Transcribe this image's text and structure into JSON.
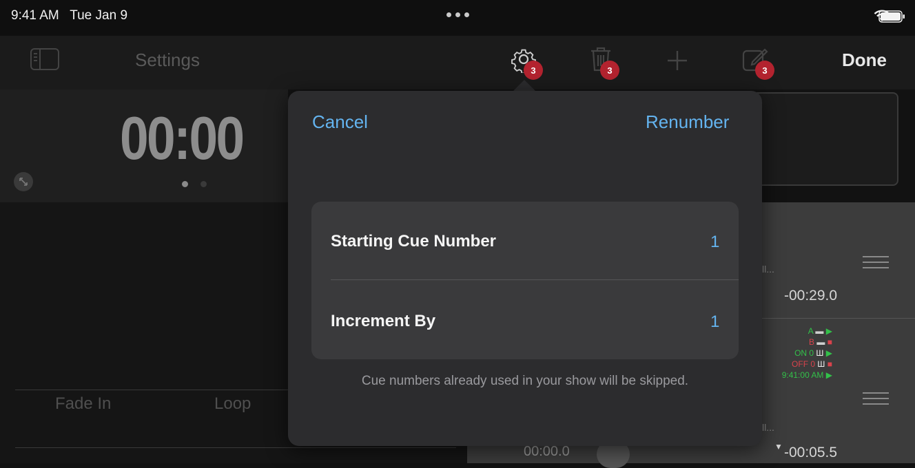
{
  "status_bar": {
    "time": "9:41 AM",
    "date": "Tue Jan 9"
  },
  "nav": {
    "title": "Settings",
    "done_label": "Done",
    "icons": [
      "sidebar-icon",
      "gear-icon",
      "trash-icon",
      "plus-icon",
      "edit-icon"
    ],
    "badges": {
      "gear": "3",
      "trash": "3",
      "edit": "3"
    }
  },
  "timer": {
    "value": "00:00"
  },
  "tabs": {
    "fade_in": "Fade In",
    "loop": "Loop"
  },
  "popover": {
    "cancel_label": "Cancel",
    "renumber_label": "Renumber",
    "rows": [
      {
        "label": "Starting Cue Number",
        "value": "1"
      },
      {
        "label": "Increment By",
        "value": "1"
      }
    ],
    "footnote": "Cue numbers already used in your show will be skipped."
  },
  "background_list": {
    "truncated": "ll...",
    "time_1": "-00:29.0",
    "time_2": "-00:05.5",
    "elapsed": "00:00.0",
    "statuses": [
      {
        "label": "A",
        "color": "#33c04a"
      },
      {
        "label": "B",
        "color": "#d9434c"
      },
      {
        "label": "ON 0",
        "color": "#33c04a"
      },
      {
        "label": "OFF 0",
        "color": "#d9434c"
      },
      {
        "label": "9:41:00 AM",
        "color": "#33c04a"
      }
    ]
  },
  "colors": {
    "accent": "#64b4f0",
    "badge": "#b3232f",
    "popover_bg": "#2c2c2e"
  }
}
